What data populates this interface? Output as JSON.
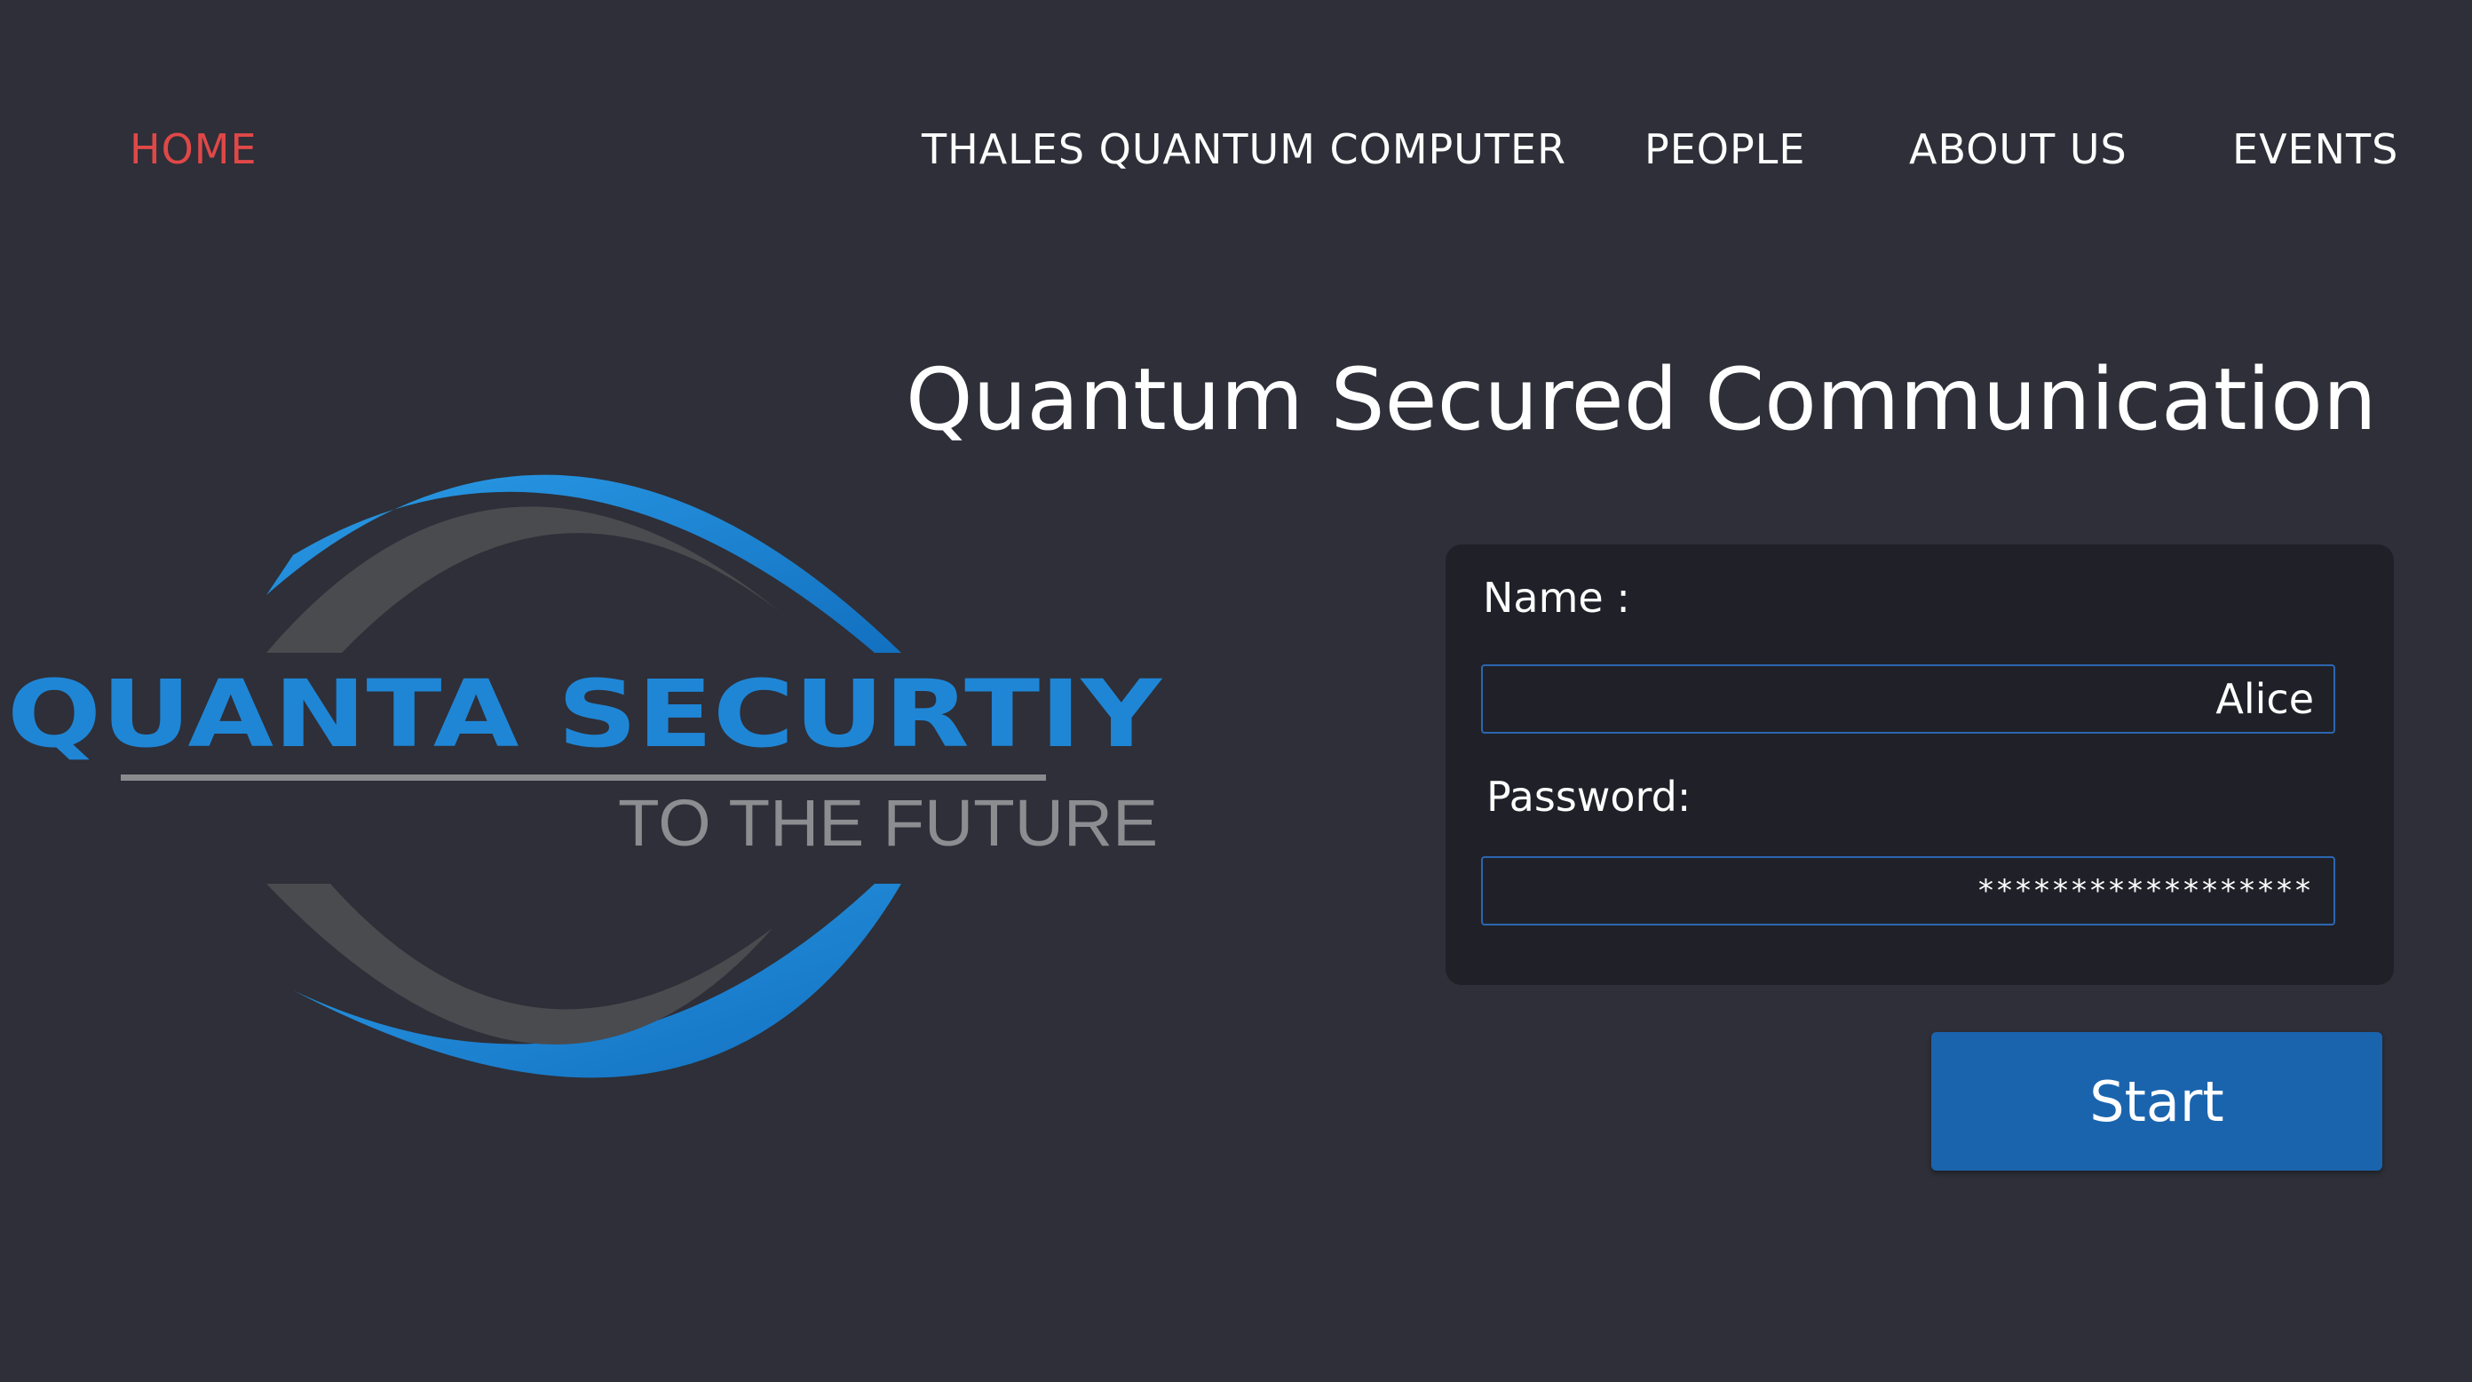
{
  "nav": {
    "items": [
      {
        "label": "HOME",
        "active": true
      },
      {
        "label": "THALES QUANTUM COMPUTER"
      },
      {
        "label": "PEOPLE"
      },
      {
        "label": "ABOUT US"
      },
      {
        "label": "EVENTS"
      }
    ]
  },
  "page": {
    "title": "Quantum Secured Communication"
  },
  "logo": {
    "brand": "QUANTA SECURTIY",
    "tagline": "TO THE FUTURE"
  },
  "form": {
    "name_label": "Name :",
    "name_value": "Alice",
    "password_label": "Password:",
    "password_value": "******************",
    "start_label": "Start"
  },
  "colors": {
    "background": "#2e2f38",
    "card": "#202128",
    "accent": "#1a64ae",
    "active_nav": "#e04848",
    "logo_blue": "#1f86d6",
    "logo_gray": "#4a4b4f"
  }
}
